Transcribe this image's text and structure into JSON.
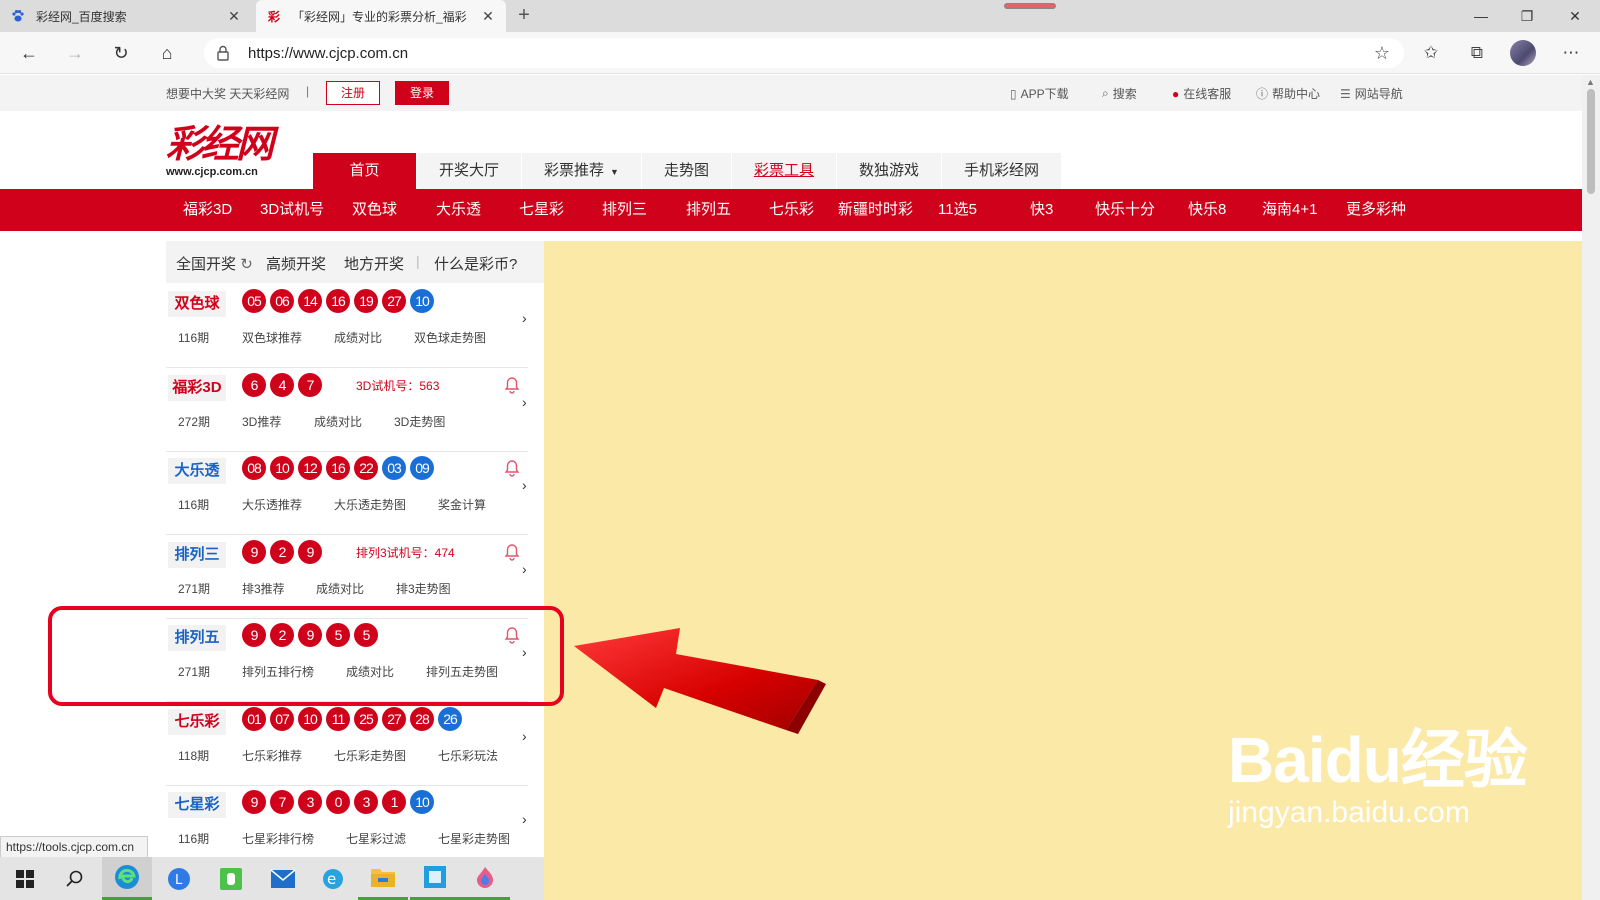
{
  "browser": {
    "tabs": [
      {
        "title": "彩经网_百度搜索",
        "active": false
      },
      {
        "title": "「彩经网」专业的彩票分析_福彩",
        "active": true
      }
    ],
    "url": "https://www.cjcp.com.cn"
  },
  "site": {
    "slogan": "想要中大奖 天天彩经网",
    "divider": "|",
    "register": "注册",
    "login": "登录",
    "utilities": [
      "APP下载",
      "搜索",
      "在线客服",
      "帮助中心",
      "网站导航"
    ],
    "logo_text": "彩经网",
    "logo_domain": "www.cjcp.com.cn",
    "main_nav": [
      "首页",
      "开奖大厅",
      "彩票推荐",
      "走势图",
      "彩票工具",
      "数独游戏",
      "手机彩经网"
    ],
    "lottery_nav": [
      "福彩3D",
      "3D试机号",
      "双色球",
      "大乐透",
      "七星彩",
      "排列三",
      "排列五",
      "七乐彩",
      "新疆时时彩",
      "11选5",
      "快3",
      "快乐十分",
      "快乐8",
      "海南4+1",
      "更多彩种"
    ]
  },
  "panel": {
    "tabs": [
      "全国开奖",
      "高频开奖",
      "地方开奖",
      "什么是彩币?"
    ],
    "lotteries": [
      {
        "name": "双色球",
        "color": "red",
        "balls": [
          [
            "05",
            "r"
          ],
          [
            "06",
            "r"
          ],
          [
            "14",
            "r"
          ],
          [
            "16",
            "r"
          ],
          [
            "19",
            "r"
          ],
          [
            "27",
            "r"
          ],
          [
            "10",
            "b"
          ]
        ],
        "extra": "",
        "bell": false,
        "issue": "116期",
        "links": [
          "双色球推荐",
          "成绩对比",
          "双色球走势图"
        ]
      },
      {
        "name": "福彩3D",
        "color": "red",
        "balls": [
          [
            "6",
            "r"
          ],
          [
            "4",
            "r"
          ],
          [
            "7",
            "r"
          ]
        ],
        "extra": "3D试机号：563",
        "bell": true,
        "issue": "272期",
        "links": [
          "3D推荐",
          "成绩对比",
          "3D走势图"
        ]
      },
      {
        "name": "大乐透",
        "color": "blue",
        "balls": [
          [
            "08",
            "r"
          ],
          [
            "10",
            "r"
          ],
          [
            "12",
            "r"
          ],
          [
            "16",
            "r"
          ],
          [
            "22",
            "r"
          ],
          [
            "03",
            "b"
          ],
          [
            "09",
            "b"
          ]
        ],
        "extra": "",
        "bell": true,
        "issue": "116期",
        "links": [
          "大乐透推荐",
          "大乐透走势图",
          "奖金计算"
        ]
      },
      {
        "name": "排列三",
        "color": "blue",
        "balls": [
          [
            "9",
            "r"
          ],
          [
            "2",
            "r"
          ],
          [
            "9",
            "r"
          ]
        ],
        "extra": "排列3试机号：474",
        "bell": true,
        "issue": "271期",
        "links": [
          "排3推荐",
          "成绩对比",
          "排3走势图"
        ]
      },
      {
        "name": "排列五",
        "color": "blue",
        "balls": [
          [
            "9",
            "r"
          ],
          [
            "2",
            "r"
          ],
          [
            "9",
            "r"
          ],
          [
            "5",
            "r"
          ],
          [
            "5",
            "r"
          ]
        ],
        "extra": "",
        "bell": true,
        "issue": "271期",
        "links": [
          "排列五排行榜",
          "成绩对比",
          "排列五走势图"
        ]
      },
      {
        "name": "七乐彩",
        "color": "red",
        "balls": [
          [
            "01",
            "r"
          ],
          [
            "07",
            "r"
          ],
          [
            "10",
            "r"
          ],
          [
            "11",
            "r"
          ],
          [
            "25",
            "r"
          ],
          [
            "27",
            "r"
          ],
          [
            "28",
            "r"
          ],
          [
            "26",
            "b"
          ]
        ],
        "extra": "",
        "bell": false,
        "issue": "118期",
        "links": [
          "七乐彩推荐",
          "七乐彩走势图",
          "七乐彩玩法"
        ]
      },
      {
        "name": "七星彩",
        "color": "blue",
        "balls": [
          [
            "9",
            "r"
          ],
          [
            "7",
            "r"
          ],
          [
            "3",
            "r"
          ],
          [
            "0",
            "r"
          ],
          [
            "3",
            "r"
          ],
          [
            "1",
            "r"
          ],
          [
            "10",
            "b"
          ]
        ],
        "extra": "",
        "bell": false,
        "issue": "116期",
        "links": [
          "七星彩排行榜",
          "七星彩过滤",
          "七星彩走势图"
        ]
      }
    ]
  },
  "status_url": "https://tools.cjcp.com.cn",
  "watermark": {
    "main": "Baidu经验",
    "sub": "jingyan.baidu.com"
  },
  "colors": {
    "brand_red": "#d0021b",
    "ball_blue": "#1a6fd6",
    "content_bg": "#fbe9a8",
    "highlight": "#e8001f"
  }
}
